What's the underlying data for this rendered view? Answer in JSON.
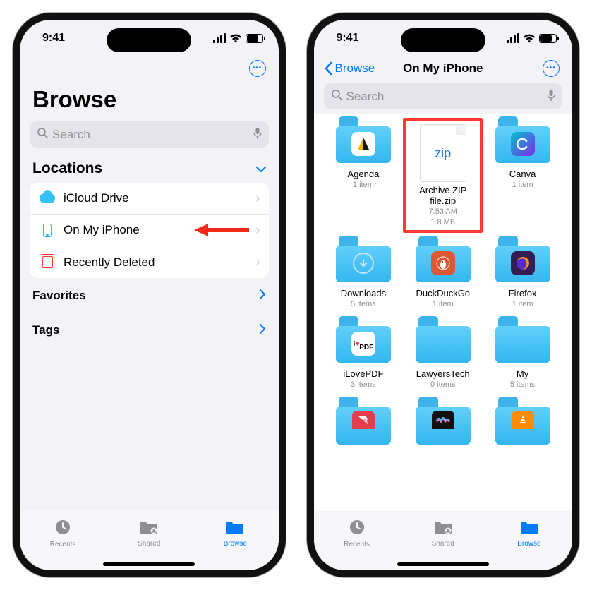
{
  "status_time": "9:41",
  "phone1": {
    "big_title": "Browse",
    "search_placeholder": "Search",
    "sections": {
      "locations_label": "Locations",
      "favorites_label": "Favorites",
      "tags_label": "Tags"
    },
    "locations": {
      "icloud": "iCloud Drive",
      "on_my_iphone": "On My iPhone",
      "recently_deleted": "Recently Deleted"
    }
  },
  "phone2": {
    "back_label": "Browse",
    "title": "On My iPhone",
    "search_placeholder": "Search",
    "items": {
      "agenda": {
        "name": "Agenda",
        "meta": "1 item"
      },
      "archive": {
        "name": "Archive ZIP file.zip",
        "time": "7:53 AM",
        "size": "1.8 MB"
      },
      "canva": {
        "name": "Canva",
        "meta": "1 item"
      },
      "downloads": {
        "name": "Downloads",
        "meta": "5 items"
      },
      "duckduckgo": {
        "name": "DuckDuckGo",
        "meta": "1 item"
      },
      "firefox": {
        "name": "Firefox",
        "meta": "1 item"
      },
      "ilovepdf": {
        "name": "iLovePDF",
        "meta": "3 items"
      },
      "lawyerstech": {
        "name": "LawyersTech",
        "meta": "0 items"
      },
      "my": {
        "name": "My",
        "meta": "5 items"
      }
    }
  },
  "tabs": {
    "recents": "Recents",
    "shared": "Shared",
    "browse": "Browse"
  },
  "zip_badge": "zip"
}
